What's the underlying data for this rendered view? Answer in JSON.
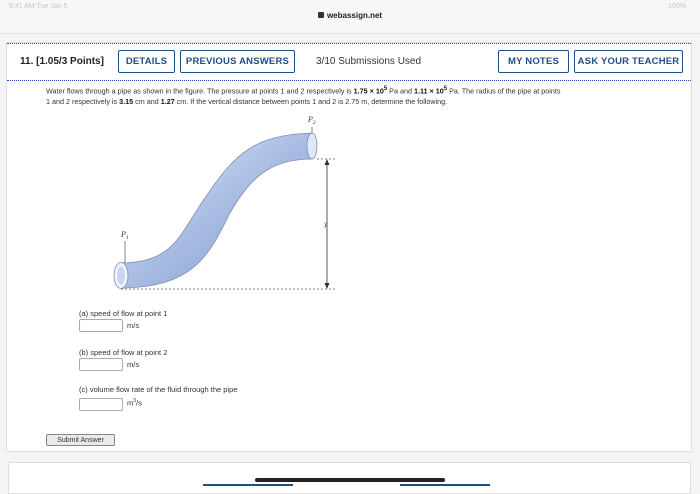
{
  "browser": {
    "url": "webassign.net",
    "status_left": "9:41 AM Tue Jan 5",
    "status_right": "100%"
  },
  "question": {
    "number_label": "11.  [1.05/3 Points]",
    "buttons": {
      "details": "DETAILS",
      "previous_answers": "PREVIOUS ANSWERS",
      "my_notes": "MY NOTES",
      "ask_teacher": "ASK YOUR TEACHER"
    },
    "submissions": "3/10 Submissions Used",
    "text": {
      "p1": "Water flows through a pipe as shown in the figure. The pressure at points 1 and 2 respectively is ",
      "pressure1": "1.75 × 10",
      "pressure1_exp": "5",
      "pa1": " Pa and ",
      "pressure2": "1.11 × 10",
      "pressure2_exp": "5",
      "p2": " Pa. The radius of the pipe at points",
      "p3": "1 and 2 respectively is ",
      "radius1": "3.15",
      "p4": " cm and ",
      "radius2": "1.27",
      "p5": " cm. If the vertical distance between points 1 and 2 is 2.75 m, determine the following."
    },
    "figure_labels": {
      "p2": "P",
      "p2_sub": "2",
      "p1": "P",
      "p1_sub": "1",
      "y": "y"
    },
    "parts": [
      {
        "label": "(a) speed of flow at point 1",
        "unit": "m/s",
        "value": ""
      },
      {
        "label": "(b) speed of flow at point 2",
        "unit": "m/s",
        "value": ""
      },
      {
        "label": "(c) volume flow rate of the fluid through the pipe",
        "unit": "m",
        "unit_sup": "3",
        "unit_tail": "/s",
        "value": ""
      }
    ],
    "submit_label": "Submit Answer"
  }
}
